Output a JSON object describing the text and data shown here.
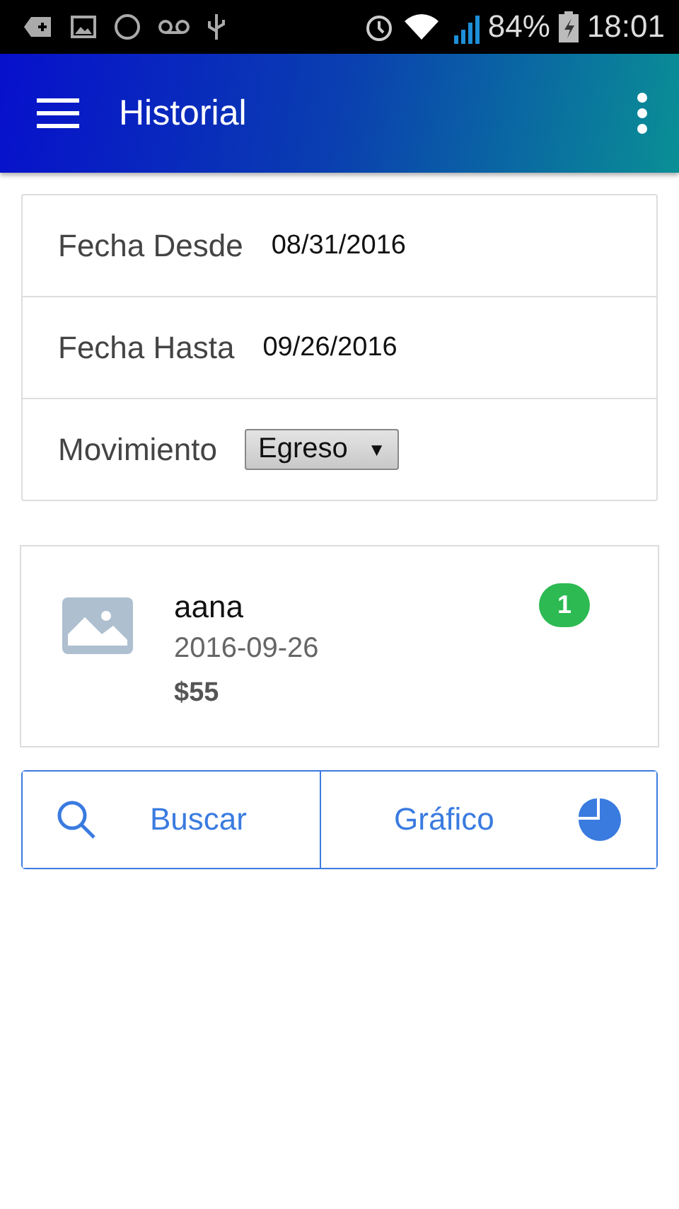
{
  "status_bar": {
    "battery": "84%",
    "time": "18:01"
  },
  "app_bar": {
    "title": "Historial"
  },
  "filters": [
    {
      "kind": "text",
      "label": "Fecha Desde",
      "value": "08/31/2016"
    },
    {
      "kind": "text",
      "label": "Fecha Hasta",
      "value": "09/26/2016"
    },
    {
      "kind": "select",
      "label": "Movimiento",
      "value": "Egreso",
      "caret": "▼"
    }
  ],
  "items": [
    {
      "name": "aana",
      "date": "2016-09-26",
      "amount": "$55",
      "badge": "1"
    }
  ],
  "buttons": [
    {
      "kind": "search",
      "label": "Buscar"
    },
    {
      "kind": "chart",
      "label": "Gráfico"
    }
  ]
}
